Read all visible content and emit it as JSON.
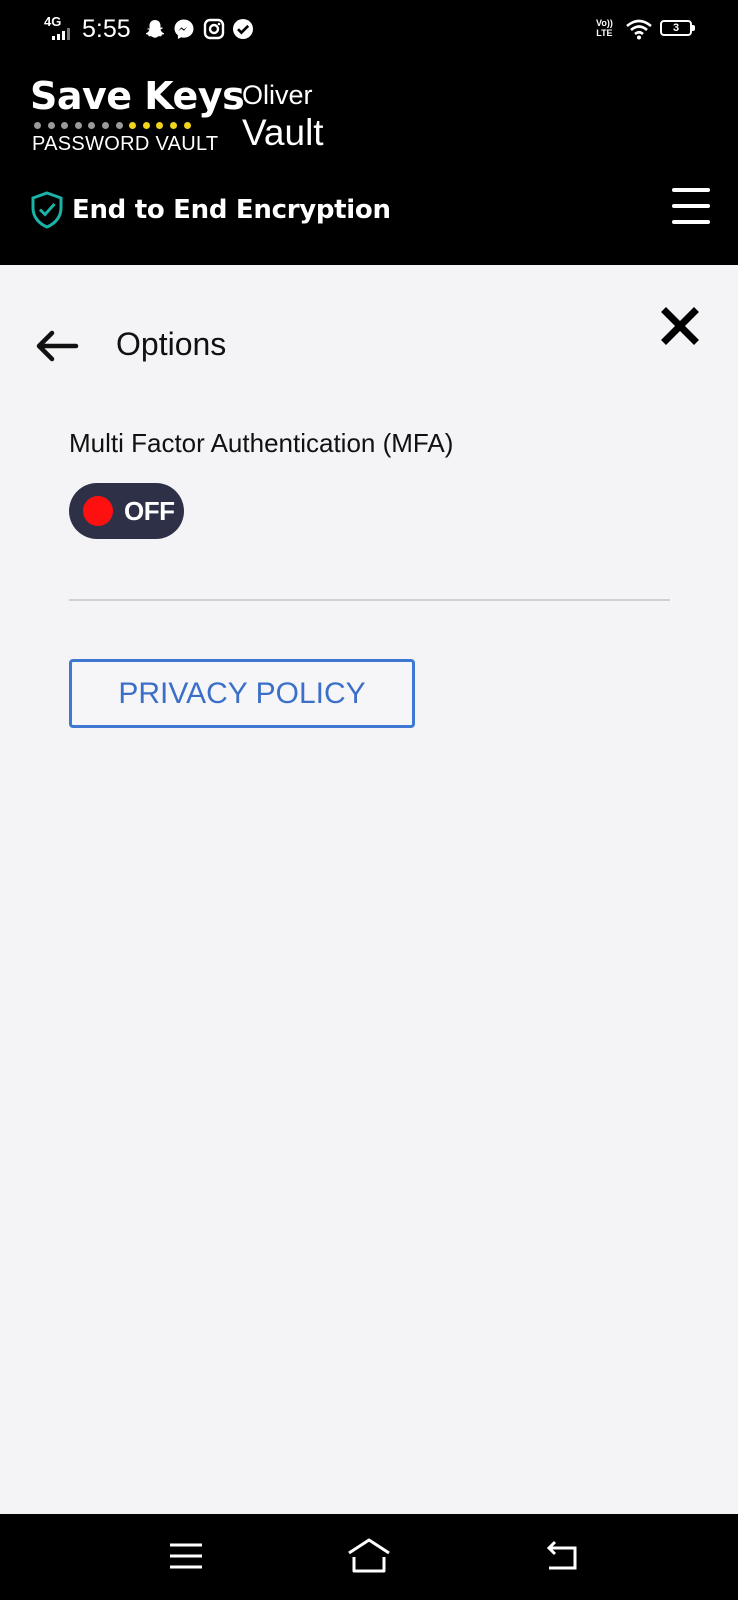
{
  "status_bar": {
    "network": "4G",
    "time": "5:55",
    "notification_icons": [
      "snapchat-icon",
      "messenger-icon",
      "instagram-icon",
      "check-circle-icon"
    ],
    "volte_line1": "Vo))",
    "volte_line2": "LTE",
    "battery_level": "3"
  },
  "header": {
    "logo_title": "Save Keys",
    "logo_subtitle": "PASSWORD VAULT",
    "logo_dot_colors": [
      "#9a9a9a",
      "#9a9a9a",
      "#9a9a9a",
      "#9a9a9a",
      "#9a9a9a",
      "#9a9a9a",
      "#9a9a9a",
      "#f2d21b",
      "#f2d21b",
      "#f2d21b",
      "#f2d21b",
      "#f2d21b"
    ],
    "owner": "Oliver",
    "vault": "Vault",
    "encryption_label": "End to End Encryption",
    "shield_color": "#19b3a8",
    "menu_icon": "hamburger-menu-icon"
  },
  "page": {
    "title": "Options",
    "back_icon": "arrow-left-icon",
    "close_icon": "close-icon"
  },
  "mfa": {
    "label": "Multi Factor Authentication (MFA)",
    "state": "OFF",
    "knob_color": "#ff1010"
  },
  "privacy": {
    "button_label": "PRIVACY POLICY",
    "accent": "#3f78d3"
  },
  "nav_bar": {
    "icons": [
      "recent-apps-icon",
      "home-icon",
      "back-nav-icon"
    ]
  }
}
